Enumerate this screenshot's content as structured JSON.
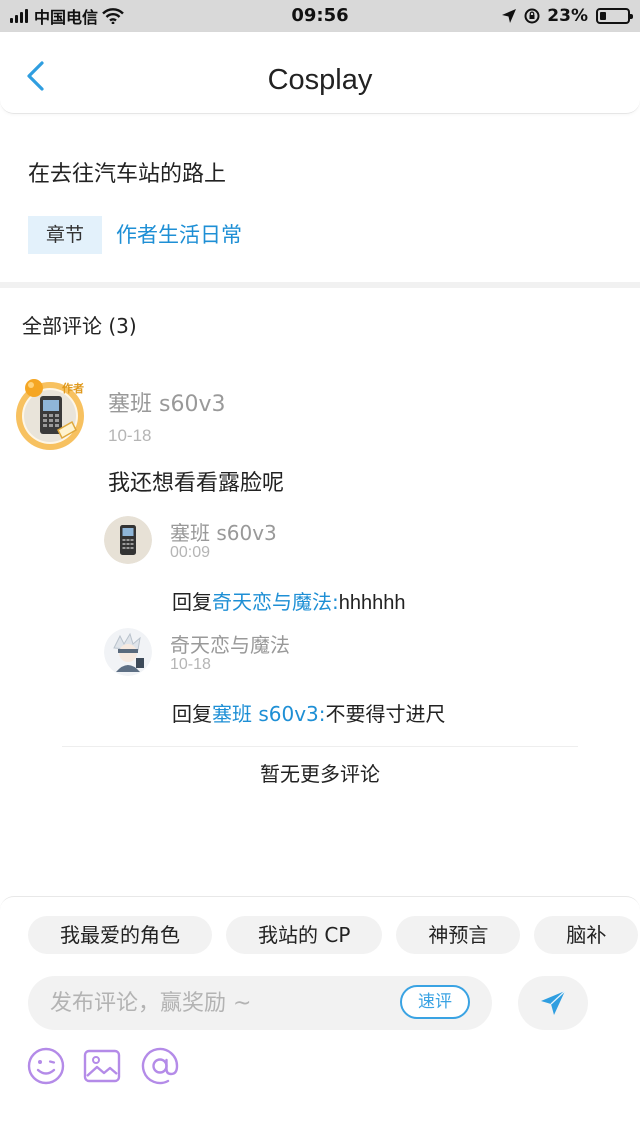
{
  "status_bar": {
    "carrier": "中国电信",
    "time": "09:56",
    "battery": "23%",
    "battery_level": 0.23
  },
  "nav": {
    "title": "Cosplay"
  },
  "post": {
    "title": "在去往汽车站的路上",
    "chapter_tag": "章节",
    "chapter_link": "作者生活日常"
  },
  "comments": {
    "header": "全部评论 (3)",
    "main": {
      "badge": "作者",
      "author": "塞班 s60v3",
      "date": "10-18",
      "text": "我还想看看露脸呢"
    },
    "replies": [
      {
        "author": "塞班 s60v3",
        "time": "00:09",
        "prefix": "回复",
        "mention": "奇天恋与魔法:",
        "body": "hhhhhh"
      },
      {
        "author": "奇天恋与魔法",
        "time": "10-18",
        "prefix": "回复",
        "mention": "塞班 s60v3:",
        "body": "不要得寸进尺"
      }
    ],
    "no_more": "暂无更多评论"
  },
  "quick_tags": [
    "我最爱的角色",
    "我站的 CP",
    "神预言",
    "脑补"
  ],
  "composer": {
    "placeholder": "发布评论，赢奖励 ~",
    "quick_review": "速评"
  },
  "colors": {
    "accent": "#1e8fd5",
    "toolbar_icon": "#b48be8"
  }
}
